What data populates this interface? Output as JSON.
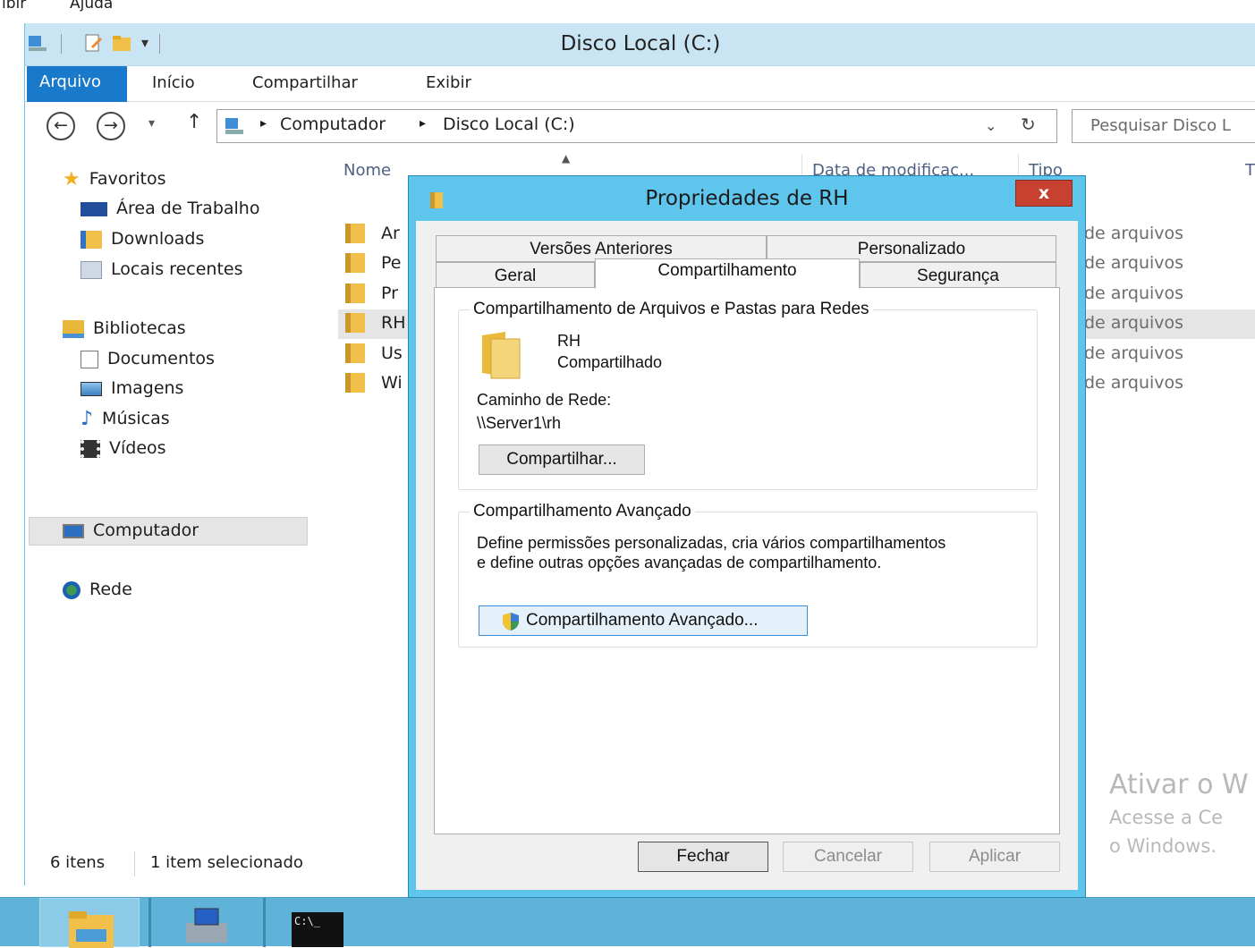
{
  "top_menu": {
    "item1": "ibir",
    "item2": "Ajuda"
  },
  "window": {
    "title": "Disco Local (C:)"
  },
  "ribbon": {
    "tabs": [
      "Arquivo",
      "Início",
      "Compartilhar",
      "Exibir"
    ]
  },
  "address": {
    "crumbs": [
      "Computador",
      "Disco Local (C:)"
    ],
    "search_placeholder": "Pesquisar Disco L"
  },
  "nav": {
    "favorites": "Favoritos",
    "favorites_items": [
      "Área de Trabalho",
      "Downloads",
      "Locais recentes"
    ],
    "libraries": "Bibliotecas",
    "libraries_items": [
      "Documentos",
      "Imagens",
      "Músicas",
      "Vídeos"
    ],
    "computer": "Computador",
    "network": "Rede"
  },
  "filelist": {
    "columns": [
      "Nome",
      "Data de modificaç...",
      "Tipo",
      "T"
    ],
    "rows": [
      {
        "name": "Ar",
        "type": "de arquivos"
      },
      {
        "name": "Pe",
        "type": "de arquivos"
      },
      {
        "name": "Pr",
        "type": "de arquivos"
      },
      {
        "name": "RH",
        "type": "de arquivos"
      },
      {
        "name": "Us",
        "type": "de arquivos"
      },
      {
        "name": "Wi",
        "type": "de arquivos"
      }
    ]
  },
  "status": {
    "count": "6 itens",
    "selected": "1 item selecionado"
  },
  "watermark": {
    "line1": "Ativar o W",
    "line2": "Acesse a Ce",
    "line3": "o Windows."
  },
  "dialog": {
    "title": "Propriedades de RH",
    "close": "x",
    "tabs_top": [
      "Versões Anteriores",
      "Personalizado"
    ],
    "tabs_bottom": [
      "Geral",
      "Compartilhamento",
      "Segurança"
    ],
    "group1_label": "Compartilhamento de Arquivos e Pastas para Redes",
    "folder_name": "RH",
    "folder_status": "Compartilhado",
    "network_path_label": "Caminho de Rede:",
    "network_path": "\\\\Server1\\rh",
    "share_button": "Compartilhar...",
    "group2_label": "Compartilhamento Avançado",
    "advanced_desc1": "Define permissões personalizadas, cria vários compartilhamentos",
    "advanced_desc2": "e define outras opções avançadas de compartilhamento.",
    "advanced_button": "Compartilhamento Avançado...",
    "buttons": [
      "Fechar",
      "Cancelar",
      "Aplicar"
    ]
  },
  "colors": {
    "accent": "#1979ca",
    "dialog_frame": "#5ec6ec",
    "taskbar": "#5fb2d8",
    "selection": "#e5e5e5"
  }
}
